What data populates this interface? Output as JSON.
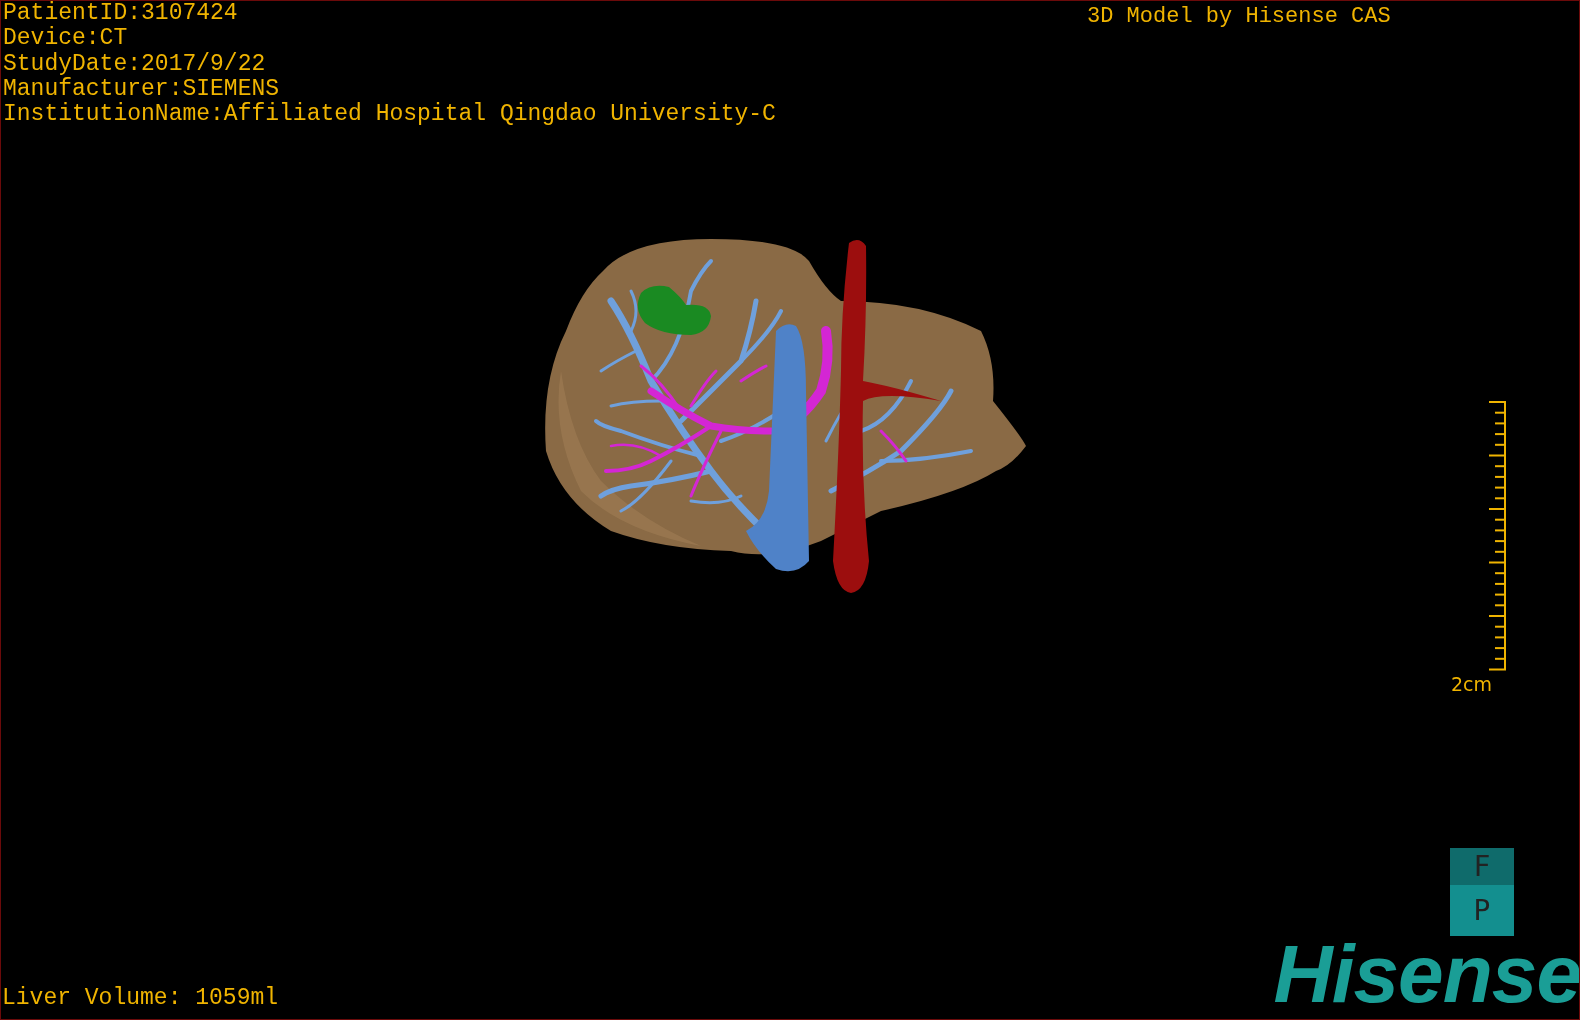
{
  "overlay": {
    "info_lines": [
      "PatientID:3107424",
      "Device:CT",
      "StudyDate:2017/9/22",
      "Manufacturer:SIEMENS",
      "InstitutionName:Affiliated Hospital Qingdao University-C"
    ],
    "title": "3D Model by Hisense CAS",
    "volume": "Liver Volume: 1059ml"
  },
  "scale_bar": {
    "label": "2cm"
  },
  "orientation_cube": {
    "faces": [
      "F",
      "P"
    ]
  },
  "logo": {
    "text": "Hisense"
  }
}
